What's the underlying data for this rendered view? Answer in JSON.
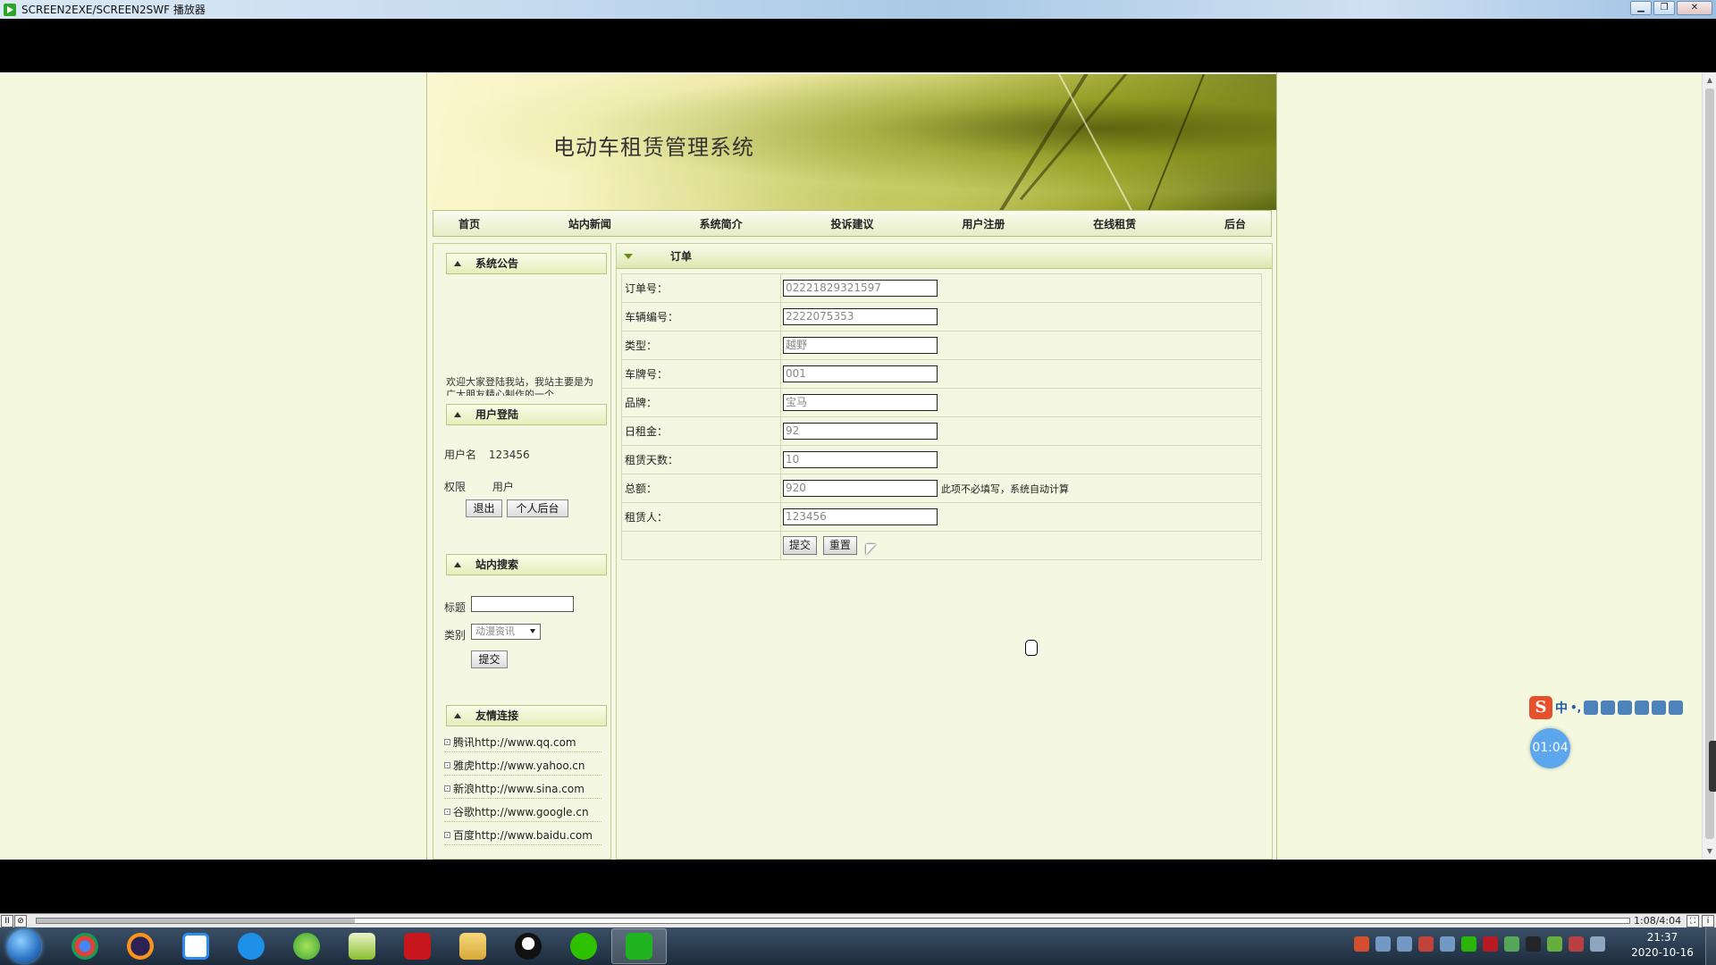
{
  "window": {
    "title": "SCREEN2EXE/SCREEN2SWF 播放器",
    "controls": {
      "minimize": "▁",
      "maximize": "❐",
      "close": "✕"
    }
  },
  "site": {
    "title": "电动车租赁管理系统",
    "nav": [
      "首页",
      "站内新闻",
      "系统简介",
      "投诉建议",
      "用户注册",
      "在线租赁",
      "后台"
    ]
  },
  "sidebar": {
    "notice": {
      "header": "系统公告",
      "text": "欢迎大家登陆我站，我站主要是为广大朋友精心制作的一个..."
    },
    "login": {
      "header": "用户登陆",
      "username_label": "用户名",
      "username_value": "123456",
      "role_label": "权限",
      "role_value": "用户",
      "logout_button": "退出",
      "personal_button": "个人后台"
    },
    "search": {
      "header": "站内搜索",
      "title_label": "标题",
      "title_value": "",
      "category_label": "类别",
      "category_value": "动漫资讯",
      "submit_button": "提交"
    },
    "links": {
      "header": "友情连接",
      "items": [
        "腾讯http://www.qq.com",
        "雅虎http://www.yahoo.cn",
        "新浪http://www.sina.com",
        "谷歌http://www.google.cn",
        "百度http://www.baidu.com"
      ]
    }
  },
  "order": {
    "header": "订单",
    "fields": [
      {
        "label": "订单号：",
        "value": "02221829321597"
      },
      {
        "label": "车辆编号：",
        "value": "2222075353"
      },
      {
        "label": "类型：",
        "value": "越野"
      },
      {
        "label": "车牌号：",
        "value": "001"
      },
      {
        "label": "品牌：",
        "value": "宝马"
      },
      {
        "label": "日租金：",
        "value": "92"
      },
      {
        "label": "租赁天数：",
        "value": "10"
      },
      {
        "label": "总额：",
        "value": "920",
        "hint": "此项不必填写，系统自动计算"
      },
      {
        "label": "租赁人：",
        "value": "123456"
      }
    ],
    "submit_button": "提交",
    "reset_button": "重置"
  },
  "overlay": {
    "ime_logo": "S",
    "ime_mode": "中",
    "ime_punct": "•,",
    "timer": "01:04"
  },
  "player": {
    "pause": "II",
    "time": "1:08/4:04",
    "progress": 0.2
  },
  "taskbar": {
    "clock_time": "21:37",
    "clock_date": "2020-10-16"
  },
  "colors": {
    "page_bg": "#f3f8df",
    "header_bg": "#e4eebb",
    "timer_bg": "#5ba6ec",
    "ime_logo": "#e5512b"
  }
}
